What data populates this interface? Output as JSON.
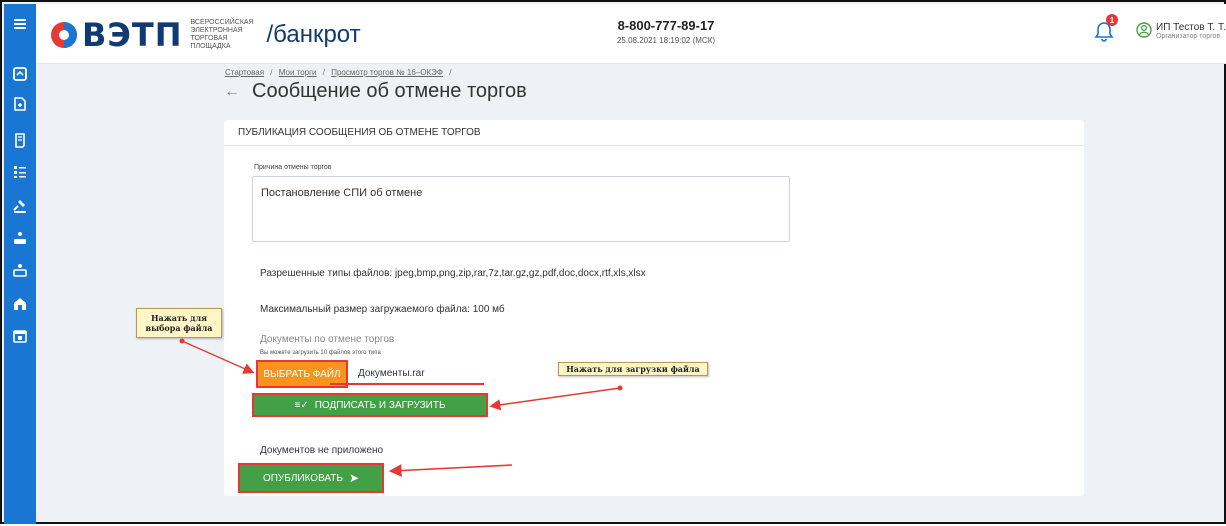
{
  "header": {
    "logo_text": "ВЭТП",
    "logo_subtitle": "ВСЕРОССИЙСКАЯ ЭЛЕКТРОННАЯ ТОРГОВАЯ ПЛОЩАДКА",
    "logo_section": "/банкрот",
    "phone": "8-800-777-89-17",
    "datetime": "25.08.2021 18:19:02 (МСК)",
    "notification_count": "1",
    "user_name": "ИП Тестов Т. Т.",
    "user_role": "Организатор торгов"
  },
  "breadcrumbs": [
    "Стартовая",
    "Мои торги",
    "Просмотр торгов № 16–ОКЭФ"
  ],
  "breadcrumb_sep": "/",
  "page_title": "Сообщение об отмене торгов",
  "form": {
    "section_title": "ПУБЛИКАЦИЯ СООБЩЕНИЯ ОБ ОТМЕНЕ ТОРГОВ",
    "reason_label": "Причина отмены торгов",
    "reason_value": "Постановление СПИ об отмене",
    "allowed_types": "Разрешенные типы файлов: jpeg,bmp,png,zip,rar,7z,tar.gz,gz,pdf,doc,docx,rtf,xls,xlsx",
    "max_size": "Максимальный размер загружаемого файла: 100 мб",
    "docs_title": "Документы по отмене торгов",
    "docs_hint": "Вы можете загрузить 10 файлов этого типа",
    "choose_file_label": "ВЫБРАТЬ ФАЙЛ",
    "file_name": "Документы.rar",
    "sign_upload_label": "ПОДПИСАТЬ И ЗАГРУЗИТЬ",
    "no_docs": "Документов не приложено",
    "publish_label": "ОПУБЛИКОВАТЬ"
  },
  "callouts": {
    "choose_file": "Нажать для выбора файла",
    "upload_file": "Нажать для загрузки файла"
  },
  "colors": {
    "sidebar": "#1976d2",
    "orange_button": "#f7941d",
    "green_button": "#43a047",
    "highlight_red": "#e53935"
  },
  "sidebar_icons": [
    "home-icon",
    "document-icon",
    "scroll-icon",
    "list-icon",
    "gavel-icon",
    "person-desk-icon",
    "person-desk-alt-icon",
    "house-icon",
    "calendar-icon"
  ]
}
